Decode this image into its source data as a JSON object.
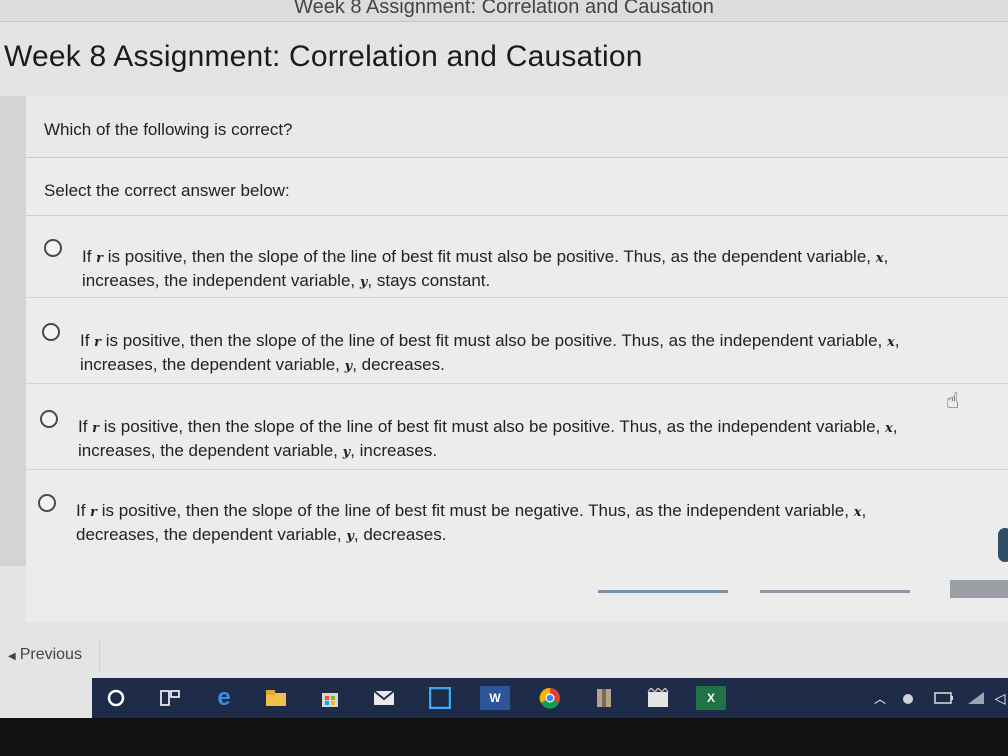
{
  "window": {
    "tab_title": "Week 8 Assignment: Correlation and Causation"
  },
  "page_title": "Week 8 Assignment: Correlation and Causation",
  "question": "Which of the following is correct?",
  "instruction": "Select the correct answer below:",
  "options": [
    {
      "p1": "If ",
      "v1": "r",
      "p2": " is positive, then the slope of the line of best fit must also be positive. Thus, as the dependent variable, ",
      "v2": "x",
      "p3": ",",
      "p4": "increases, the independent variable, ",
      "v3": "y",
      "p5": ", stays constant."
    },
    {
      "p1": "If ",
      "v1": "r",
      "p2": " is positive, then the slope of the line of best fit must also be positive. Thus, as the independent variable, ",
      "v2": "x",
      "p3": ",",
      "p4": "increases, the dependent variable, ",
      "v3": "y",
      "p5": ", decreases."
    },
    {
      "p1": "If ",
      "v1": "r",
      "p2": " is positive, then the slope of the line of best fit must also be positive. Thus, as the independent variable, ",
      "v2": "x",
      "p3": ",",
      "p4": "increases, the dependent variable, ",
      "v3": "y",
      "p5": ", increases."
    },
    {
      "p1": "If ",
      "v1": "r",
      "p2": " is positive, then the slope of the line of best fit must be negative. Thus, as the independent variable, ",
      "v2": "x",
      "p3": ",",
      "p4": "decreases, the dependent variable, ",
      "v3": "y",
      "p5": ", decreases."
    }
  ],
  "navigation": {
    "previous_label": "Previous"
  },
  "taskbar": {
    "icons": [
      "cortana-icon",
      "task-view-icon",
      "edge-icon",
      "file-explorer-icon",
      "store-icon",
      "mail-icon",
      "app-icon",
      "word-icon",
      "chrome-icon",
      "app-icon-2",
      "app-icon-3",
      "excel-icon"
    ],
    "word_label": "W",
    "excel_label": "X"
  },
  "colors": {
    "taskbar_bg": "#1e2c4a",
    "page_bg": "#e4e4e4"
  }
}
